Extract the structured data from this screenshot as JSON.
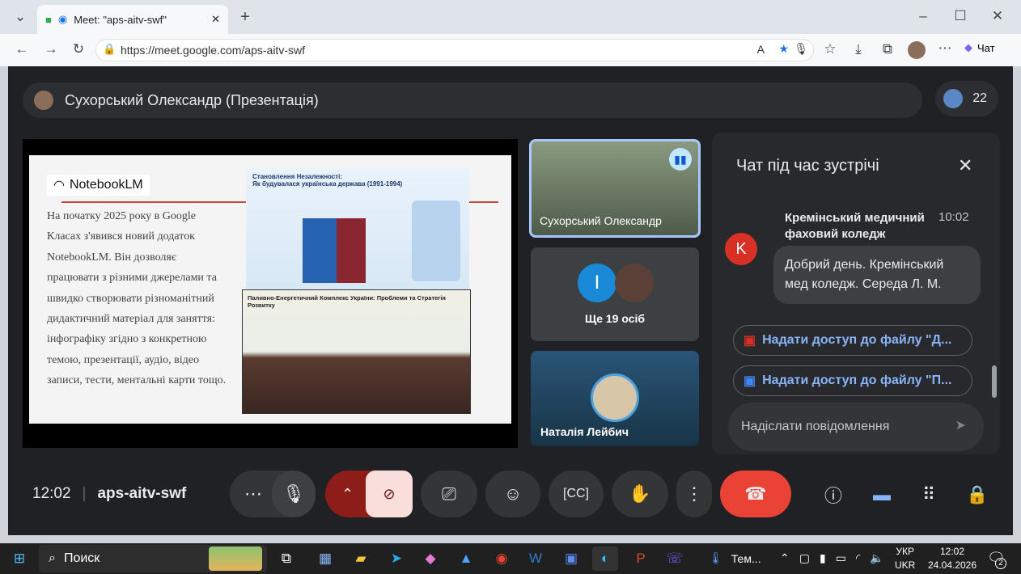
{
  "browser": {
    "tab_title": "Meet: \"aps-aitv-swf\"",
    "url": "https://meet.google.com/aps-aitv-swf",
    "copilot_label": "Чат"
  },
  "meet": {
    "presenter_title": "Сухорський Олександр (Презентація)",
    "participant_count": "22",
    "slide": {
      "logo_text": "NotebookLM",
      "body_text": "На початку 2025 року в Google Класах з'явився новий додаток NotebookLM. Він дозволяє працювати з різними джерелами та швидко створювати різноманітний дидактичний матеріал для заняття: інфографіку згідно з конкретною темою, презентації, аудіо, відео записи, тести, ментальні карти тощо.",
      "infographic1_title_line1": "Становлення Незалежності:",
      "infographic1_title_line2": "Як будувалася українська держава (1991-1994)",
      "infographic2_title": "Паливно-Енергетичний Комплекс України: Проблеми та Стратегія Розвитку"
    },
    "tiles": [
      {
        "name": "Сухорський Олександр"
      },
      {
        "name": "Ще 19 осіб",
        "avatar_letter": "I"
      },
      {
        "name": "Наталія Лейбич"
      }
    ],
    "chat": {
      "title": "Чат під час зустрічі",
      "sender": "Кремінський медичний фаховий коледж",
      "sender_initial": "K",
      "time": "10:02",
      "message": "Добрий день. Кремінський мед коледж. Середа Л. М.",
      "file_buttons": [
        "Надати доступ до файлу \"Д...",
        "Надати доступ до файлу \"П..."
      ],
      "input_placeholder": "Надіслати повідомлення"
    },
    "bottom": {
      "time": "12:02",
      "meeting_code": "aps-aitv-swf"
    },
    "colors": {
      "background": "#202124",
      "end_call": "#ea4335",
      "camera_off": "#f9dedc",
      "accent": "#8ab4f8"
    }
  },
  "taskbar": {
    "search_label": "Поиск",
    "weather_label": "Тем...",
    "lang_top": "УКР",
    "lang_bottom": "UKR",
    "clock_time": "12:02",
    "clock_date": "24.04.2026",
    "notification_count": "2"
  }
}
